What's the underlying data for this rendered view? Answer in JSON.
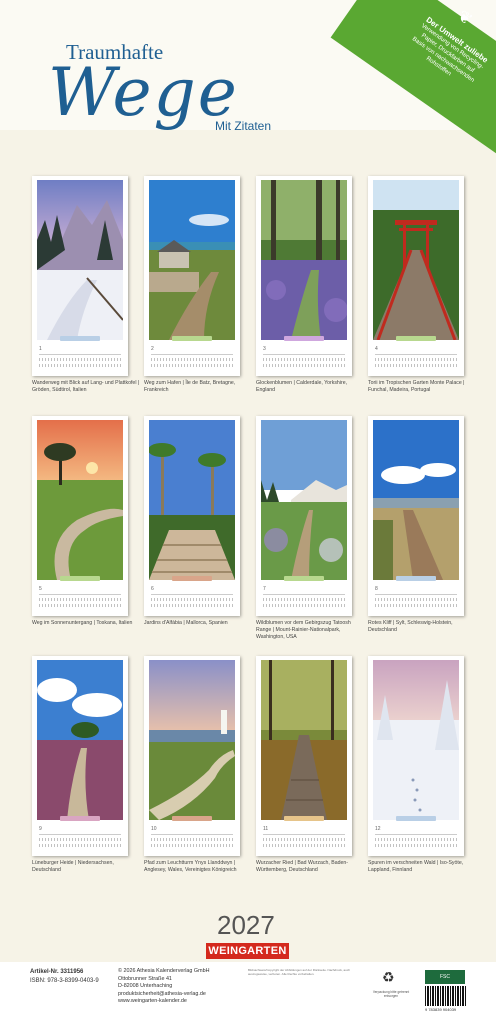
{
  "title": {
    "line1": "Traumhafte",
    "line2": "Wege",
    "sub": "Mit Zitaten"
  },
  "eco_badge": {
    "icon": "leaf-icon",
    "title": "Der Umwelt zuliebe",
    "lines": [
      "Verwendung von Recycling-",
      "Papier, Druckfarben auf",
      "Basis von nachwachsenden",
      "Rohstoffen"
    ]
  },
  "months": [
    {
      "num": "1",
      "caption": "Wanderweg mit Blick auf Lang- und Plattkofel | Gröden, Südtirol, Italien"
    },
    {
      "num": "2",
      "caption": "Weg zum Hafen | Île de Batz, Bretagne, Frankreich"
    },
    {
      "num": "3",
      "caption": "Glockenblumen | Calderdale, Yorkshire, England"
    },
    {
      "num": "4",
      "caption": "Torii im Tropischen Garten Monte Palace | Funchal, Madeira, Portugal"
    },
    {
      "num": "5",
      "caption": "Weg im Sonnenuntergang | Toskana, Italien"
    },
    {
      "num": "6",
      "caption": "Jardins d'Alfàbia | Mallorca, Spanien"
    },
    {
      "num": "7",
      "caption": "Wildblumen vor dem Gebirgszug Tatoosh Range | Mount-Rainier-Nationalpark, Washington, USA"
    },
    {
      "num": "8",
      "caption": "Rotes Kliff | Sylt, Schleswig-Holstein, Deutschland"
    },
    {
      "num": "9",
      "caption": "Lüneburger Heide | Niedersachsen, Deutschland"
    },
    {
      "num": "10",
      "caption": "Pfad zum Leuchtturm Ynys Llanddwyn | Anglesey, Wales, Vereinigtes Königreich"
    },
    {
      "num": "11",
      "caption": "Wurzacher Ried | Bad Wurzach, Baden-Württemberg, Deutschland"
    },
    {
      "num": "12",
      "caption": "Spuren im verschneiten Wald | Iso-Syöte, Lappland, Finnland"
    }
  ],
  "year": "2027",
  "brand": "WEINGARTEN",
  "footer": {
    "article_label": "Artikel-Nr. 3311956",
    "isbn": "ISBN: 978-3-8399-0403-9",
    "address": [
      "© 2026 Athesia Kalenderverlag GmbH",
      "Ottobrunner Straße 41",
      "D-82008 Unterhaching",
      "produktsicherheit@athesia-verlag.de",
      "www.weingarten-kalender.de"
    ],
    "fine_print": "Bildnachweis/Copyright der Abbildungen auf der Rückseite. Nachdruck, auch auszugsweise, verboten. Alle Rechte vorbehalten.",
    "recycle_text": "Verpackung bitte getrennt entsorgen",
    "fsc": "FSC",
    "barcode_number": "9 783839 904039"
  },
  "colors": {
    "title_blue": "#1f5f92",
    "eco_green": "#5aa832",
    "brand_red": "#d4291d"
  }
}
